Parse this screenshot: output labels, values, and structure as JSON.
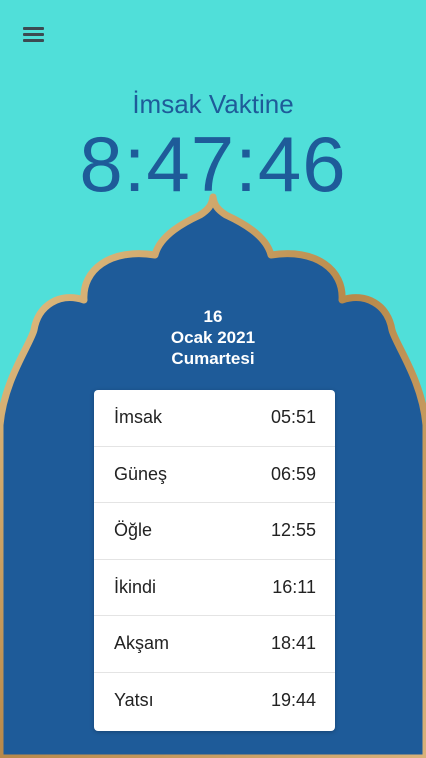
{
  "header": {
    "menu_icon": "hamburger-menu-icon",
    "headline": "İmsak Vaktine",
    "countdown": "8:47:46"
  },
  "date": {
    "day": "16",
    "month_year": "Ocak 2021",
    "weekday": "Cumartesi"
  },
  "prayer_times": [
    {
      "name": "İmsak",
      "time": "05:51"
    },
    {
      "name": "Güneş",
      "time": "06:59"
    },
    {
      "name": "Öğle",
      "time": "12:55"
    },
    {
      "name": "İkindi",
      "time": "16:11"
    },
    {
      "name": "Akşam",
      "time": "18:41"
    },
    {
      "name": "Yatsı",
      "time": "19:44"
    }
  ],
  "colors": {
    "background_top": "#50DFD9",
    "dome_fill": "#1E5B99",
    "dome_border": "#C8A063",
    "card": "#FFFFFF",
    "text_dark": "#222222"
  }
}
